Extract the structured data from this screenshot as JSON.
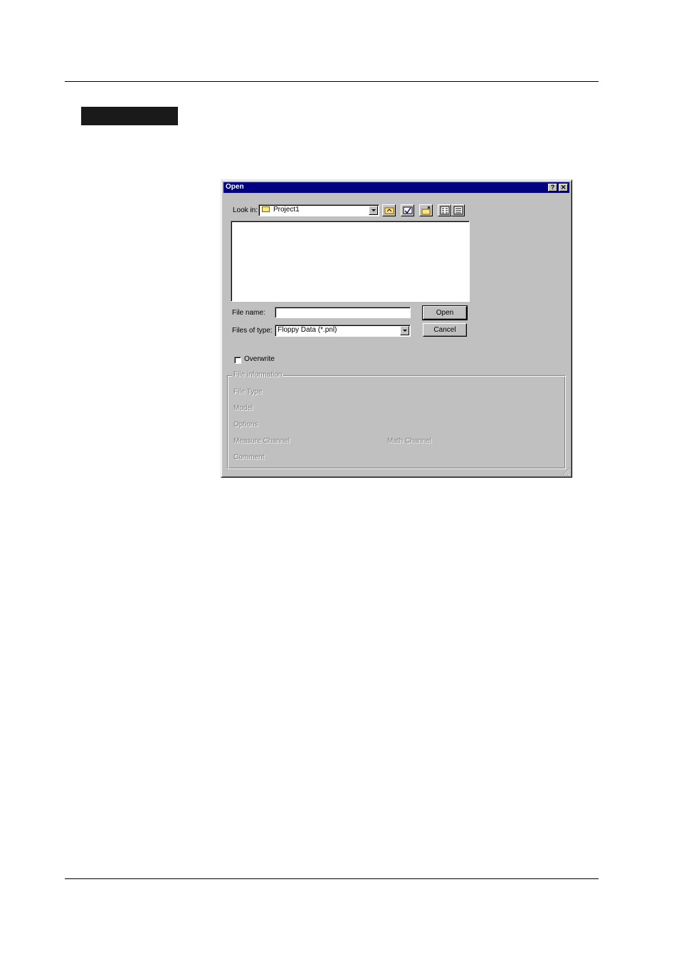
{
  "dialog": {
    "title": "Open",
    "help_glyph": "?",
    "close_glyph": "✕",
    "look_in": {
      "label": "Look in:",
      "value": "Project1"
    },
    "toolbar_icons": [
      "up-one-level-icon",
      "desktop-icon",
      "new-folder-icon",
      "list-view-icon",
      "details-view-icon"
    ],
    "file_name": {
      "label": "File name:",
      "value": ""
    },
    "files_of_type": {
      "label": "Files of type:",
      "value": "Floppy Data (*.pnl)"
    },
    "open_button": "Open",
    "cancel_button": "Cancel",
    "overwrite_label": "Overwrite",
    "file_information": {
      "legend": "File information",
      "file_type": "File Type",
      "model": "Model",
      "options": "Options",
      "measure_channel": "Measure Channel",
      "math_channel": "Math Channel",
      "comment": "Comment"
    }
  }
}
